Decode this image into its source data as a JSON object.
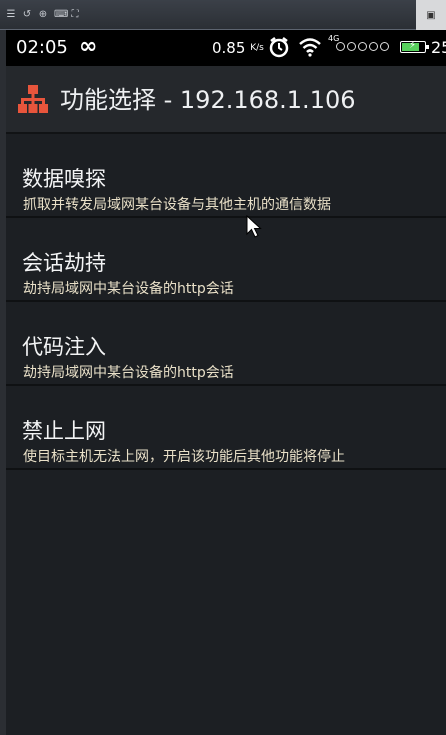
{
  "host_toolbar": {
    "icons": [
      "menu-icon",
      "rotate-icon",
      "zoom-icon",
      "keyboard-icon",
      "fullscreen-icon"
    ],
    "right_icon": "window-icon"
  },
  "status_bar": {
    "time": "02:05",
    "loop_symbol": "∞",
    "net_speed": "0.85",
    "net_speed_unit": "K/s",
    "network_type": "4G",
    "battery_color": "#58d15d",
    "battery_text": "25"
  },
  "action_bar": {
    "title": "功能选择 - 192.168.1.106",
    "icon": "network-topology-icon",
    "icon_color": "#e8553c"
  },
  "list": {
    "items": [
      {
        "title": "数据嗅探",
        "subtitle": "抓取并转发局域网某台设备与其他主机的通信数据"
      },
      {
        "title": "会话劫持",
        "subtitle": "劫持局域网中某台设备的http会话"
      },
      {
        "title": "代码注入",
        "subtitle": "劫持局域网中某台设备的http会话"
      },
      {
        "title": "禁止上网",
        "subtitle": "使目标主机无法上网，开启该功能后其他功能将停止"
      }
    ]
  }
}
